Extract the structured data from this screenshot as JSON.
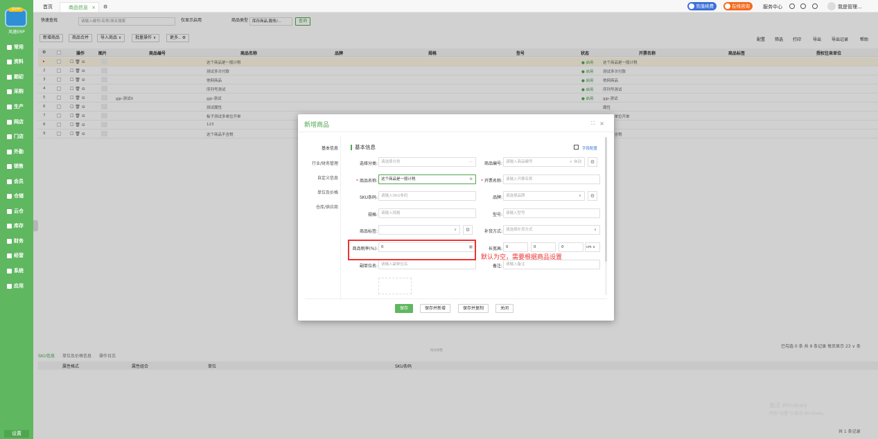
{
  "app": {
    "logo_badge": "云ERP",
    "logo_name": "风速ERP",
    "settings": "设置",
    "brand_color": "#5fb760",
    "alert_color": "#e33333"
  },
  "sidebar": {
    "items": [
      {
        "label": "常用",
        "icon": "star-icon"
      },
      {
        "label": "资料",
        "icon": "file-icon"
      },
      {
        "label": "期初",
        "icon": "target-icon"
      },
      {
        "label": "采购",
        "icon": "cart-icon"
      },
      {
        "label": "生产",
        "icon": "factory-icon"
      },
      {
        "label": "网店",
        "icon": "shop-icon"
      },
      {
        "label": "门店",
        "icon": "store-icon"
      },
      {
        "label": "外勤",
        "icon": "location-icon"
      },
      {
        "label": "销售",
        "icon": "sales-icon"
      },
      {
        "label": "会员",
        "icon": "member-icon"
      },
      {
        "label": "仓储",
        "icon": "warehouse-icon"
      },
      {
        "label": "云仓",
        "icon": "cloud-icon"
      },
      {
        "label": "库存",
        "icon": "stock-icon"
      },
      {
        "label": "财务",
        "icon": "finance-icon"
      },
      {
        "label": "经营",
        "icon": "business-icon"
      },
      {
        "label": "系统",
        "icon": "system-icon"
      },
      {
        "label": "应用",
        "icon": "app-icon"
      }
    ]
  },
  "topbar": {
    "tabs": [
      {
        "label": "首页"
      },
      {
        "label": "商品信息",
        "active": true
      }
    ],
    "pill_recharge": "充值续费",
    "pill_consult": "在线咨询",
    "service_center": "服务中心",
    "user": "我是管理...",
    "tab_close": "×",
    "settings_glyph": "⚙"
  },
  "filter": {
    "quick_search": "快速查找",
    "search_placeholder": "请输入编号/名称/简名搜索",
    "show_enabled": "仅显示启用",
    "type_label": "商品类型",
    "type_value": "库存商品,服务/...",
    "query_btn": "查询"
  },
  "toolbar": {
    "buttons": [
      "新增商品",
      "商品合并",
      "导入商品 ∨",
      "批量操作 ∨",
      "更多.. ⚙"
    ],
    "right": [
      "配置",
      "筛选",
      "打印",
      "导出",
      "导出记录",
      "帮助"
    ]
  },
  "grid": {
    "columns": [
      "操作",
      "图片",
      "商品编号",
      "商品名称",
      "品牌",
      "规格",
      "型号",
      "状态",
      "开票名称",
      "商品标签",
      "授权往来单位"
    ],
    "rows": [
      {
        "no": "▸",
        "code": "",
        "name": "这个商品是一般计税",
        "status": "● 启用",
        "invoice": "这个商品是一般计税"
      },
      {
        "no": "2",
        "code": "",
        "name": "测试多次付款",
        "status": "● 启用",
        "invoice": "测试多次付款"
      },
      {
        "no": "3",
        "code": "",
        "name": "他网商品",
        "status": "● 启用",
        "invoice": "他网商品"
      },
      {
        "no": "4",
        "code": "",
        "name": "序列号测试",
        "status": "● 启用",
        "invoice": "序列号测试"
      },
      {
        "no": "5",
        "code": "gjp-测试0",
        "name": "gjp-测试",
        "status": "● 启用",
        "invoice": "gjp-测试"
      },
      {
        "no": "6",
        "code": "",
        "name": "测试属性",
        "status": "",
        "invoice": "属性"
      },
      {
        "no": "7",
        "code": "",
        "name": "板子测试多单位开单",
        "status": "",
        "invoice": "测试多单位开单"
      },
      {
        "no": "8",
        "code": "",
        "name": "123",
        "status": "",
        "invoice": ""
      },
      {
        "no": "9",
        "code": "",
        "name": "这个商品不含税",
        "status": "",
        "invoice": "商品不含税"
      }
    ],
    "ops": "☐ 🗑 ⊖",
    "pager": "已勾选 0 条 共 9 条记录 每页显示 23 ∨ 条",
    "drag_hint": "拖动调整"
  },
  "bottom": {
    "tabs": [
      "SKU信息",
      "单位及价格信息",
      "操作日志"
    ],
    "columns": [
      "属性格式",
      "属性组合",
      "单位",
      "SKU条码"
    ],
    "total": "共 1 条记录",
    "watermark_1": "激活 Windows",
    "watermark_2": "转到“设置”以激活 Windows。"
  },
  "modal": {
    "title": "新增商品",
    "close": "×",
    "expand": "⛶",
    "nav": [
      "基本信息",
      "行业/财务管理",
      "自定义信息",
      "单位及价格",
      "仓库/供应商"
    ],
    "section_title": "基本信息",
    "field_config": "字段配置",
    "fields": {
      "category": {
        "label": "选择分类:",
        "placeholder": "请选择分类",
        "suffix": "···"
      },
      "code": {
        "label": "商品编号:",
        "placeholder": "请输入商品编号",
        "suffix": "+ 自动"
      },
      "name": {
        "label": "商品名称:",
        "value": "这个商品是一般计税",
        "suffix": "⊗"
      },
      "invoice": {
        "label": "开票名称:",
        "placeholder": "请输入开票名称"
      },
      "sku": {
        "label": "SKU条码:",
        "placeholder": "请输入SKU条码"
      },
      "brand": {
        "label": "品牌:",
        "placeholder": "请选择品牌",
        "suffix": "∨"
      },
      "spec": {
        "label": "规格:",
        "placeholder": "请输入规格"
      },
      "model": {
        "label": "型号:",
        "placeholder": "请输入型号"
      },
      "tag": {
        "label": "商品标签:",
        "placeholder": "",
        "suffix": "∨"
      },
      "replenish": {
        "label": "补货方式:",
        "placeholder": "请选择补货方式",
        "suffix": "∨"
      },
      "tax": {
        "label": "商品税率(%):",
        "value": "0",
        "suffix": "▦"
      },
      "dims": {
        "label": "长宽高:",
        "l": "0",
        "w": "0",
        "h": "0",
        "unit": "cm ∨"
      },
      "sub_unit": {
        "label": "副单位名:",
        "placeholder": "请输入副单位名"
      },
      "remark": {
        "label": "备注:",
        "placeholder": "请输入备注"
      }
    },
    "buttons": [
      "保存",
      "保存并新增",
      "保存并复制",
      "关闭"
    ]
  },
  "annotation": "默认为空，需要根据商品设置"
}
